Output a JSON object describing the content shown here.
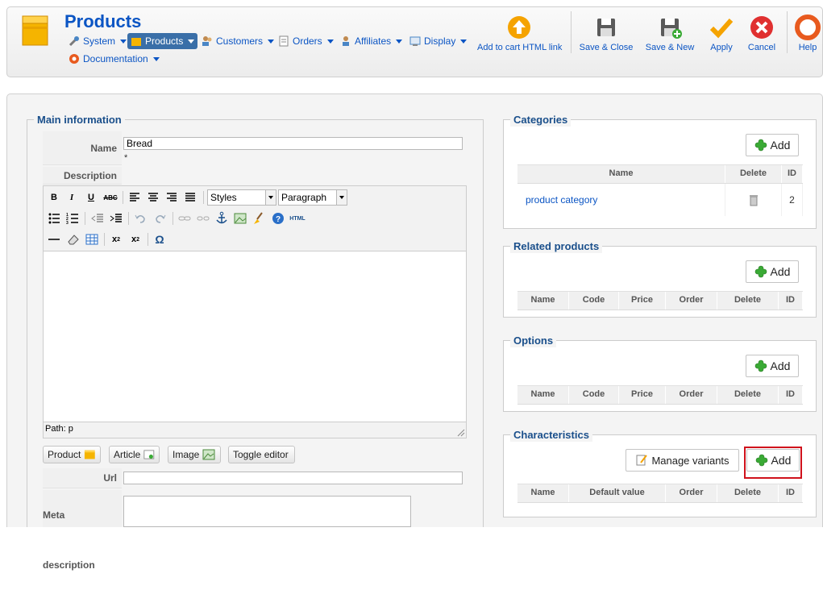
{
  "header": {
    "title": "Products",
    "menu": [
      {
        "label": "System"
      },
      {
        "label": "Products"
      },
      {
        "label": "Customers"
      },
      {
        "label": "Orders"
      },
      {
        "label": "Affiliates"
      },
      {
        "label": "Display"
      },
      {
        "label": "Documentation"
      }
    ],
    "toolbar": {
      "add_to_cart": "Add to cart HTML link",
      "save_close": "Save & Close",
      "save_new": "Save & New",
      "apply": "Apply",
      "cancel": "Cancel",
      "help": "Help"
    }
  },
  "main_info": {
    "legend": "Main information",
    "name_label": "Name",
    "name_value": "Bread",
    "required_mark": "*",
    "description_label": "Description",
    "styles_select": "Styles",
    "paragraph_select": "Paragraph",
    "html_label": "HTML",
    "omega": "Ω",
    "path_label": "Path: p",
    "buttons": {
      "product": "Product",
      "article": "Article",
      "image": "Image",
      "toggle": "Toggle editor"
    },
    "url_label": "Url",
    "meta_description_label": "Meta description"
  },
  "categories": {
    "legend": "Categories",
    "add_label": "Add",
    "columns": [
      "Name",
      "Delete",
      "ID"
    ],
    "rows": [
      {
        "name": "product category",
        "id": "2"
      }
    ]
  },
  "related": {
    "legend": "Related products",
    "add_label": "Add",
    "columns": [
      "Name",
      "Code",
      "Price",
      "Order",
      "Delete",
      "ID"
    ]
  },
  "options": {
    "legend": "Options",
    "add_label": "Add",
    "columns": [
      "Name",
      "Code",
      "Price",
      "Order",
      "Delete",
      "ID"
    ]
  },
  "characteristics": {
    "legend": "Characteristics",
    "manage_label": "Manage variants",
    "add_label": "Add",
    "columns": [
      "Name",
      "Default value",
      "Order",
      "Delete",
      "ID"
    ]
  },
  "colors": {
    "accent": "#0b55c4",
    "legend_blue": "#1a4f8b",
    "highlight": "#d0121c",
    "add_green": "#3aaa35"
  }
}
